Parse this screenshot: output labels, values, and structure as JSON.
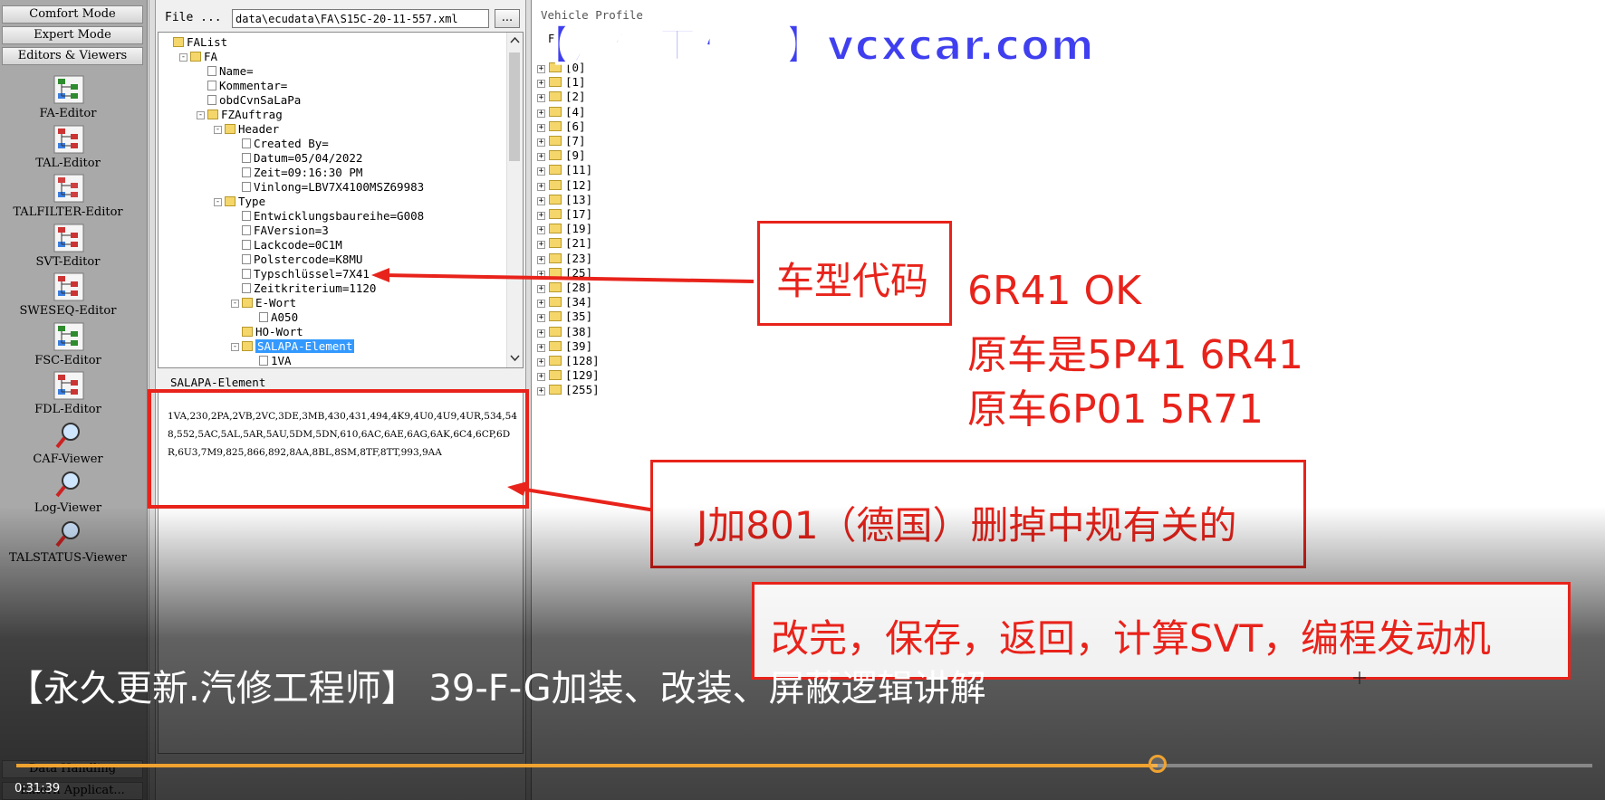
{
  "left_toolbar": {
    "modes": [
      "Comfort Mode",
      "Expert Mode",
      "Editors & Viewers"
    ],
    "tools": [
      {
        "label": "FA-Editor",
        "icon": "fa-editor-icon"
      },
      {
        "label": "TAL-Editor",
        "icon": "tal-editor-icon"
      },
      {
        "label": "TALFILTER-Editor",
        "icon": "talfilter-editor-icon"
      },
      {
        "label": "SVT-Editor",
        "icon": "svt-editor-icon"
      },
      {
        "label": "SWESEQ-Editor",
        "icon": "sweseq-editor-icon"
      },
      {
        "label": "FSC-Editor",
        "icon": "fsc-editor-icon"
      },
      {
        "label": "FDL-Editor",
        "icon": "fdl-editor-icon"
      },
      {
        "label": "CAF-Viewer",
        "icon": "magnifier-icon"
      },
      {
        "label": "Log-Viewer",
        "icon": "magnifier-icon"
      },
      {
        "label": "TALSTATUS-Viewer",
        "icon": "magnifier-icon"
      }
    ],
    "bottom_buttons": [
      "Data Handling",
      "Extern Applicat..."
    ]
  },
  "file": {
    "label": "File ...",
    "path": "data\\ecudata\\FA\\S15C-20-11-557.xml",
    "browse_label": "..."
  },
  "tree": [
    {
      "text": "FAList",
      "icon": "folder",
      "pm": "none"
    },
    {
      "text": "FA",
      "icon": "folder",
      "pm": "-"
    },
    {
      "text": "Name=",
      "icon": "doc",
      "pm": "none"
    },
    {
      "text": "Kommentar=",
      "icon": "doc",
      "pm": "none"
    },
    {
      "text": "obdCvnSaLaPa",
      "icon": "doc",
      "pm": "none"
    },
    {
      "text": "FZAuftrag",
      "icon": "folder",
      "pm": "-"
    },
    {
      "text": "Header",
      "icon": "folder",
      "pm": "-"
    },
    {
      "text": "Created By=",
      "icon": "doc",
      "pm": "none"
    },
    {
      "text": "Datum=05/04/2022",
      "icon": "doc",
      "pm": "none"
    },
    {
      "text": "Zeit=09:16:30 PM",
      "icon": "doc",
      "pm": "none"
    },
    {
      "text": "Vinlong=LBV7X4100MSZ69983",
      "icon": "doc",
      "pm": "none"
    },
    {
      "text": "Type",
      "icon": "folder",
      "pm": "-"
    },
    {
      "text": "Entwicklungsbaureihe=G008",
      "icon": "doc",
      "pm": "none"
    },
    {
      "text": "FAVersion=3",
      "icon": "doc",
      "pm": "none"
    },
    {
      "text": "Lackcode=0C1M",
      "icon": "doc",
      "pm": "none"
    },
    {
      "text": "Polstercode=K8MU",
      "icon": "doc",
      "pm": "none"
    },
    {
      "text": "Typschlüssel=7X41",
      "icon": "doc",
      "pm": "none"
    },
    {
      "text": "Zeitkriterium=1120",
      "icon": "doc",
      "pm": "none"
    },
    {
      "text": "E-Wort",
      "icon": "folder",
      "pm": "-"
    },
    {
      "text": "A050",
      "icon": "doc",
      "pm": "none"
    },
    {
      "text": "HO-Wort",
      "icon": "folder",
      "pm": "none"
    },
    {
      "text": "SALAPA-Element",
      "icon": "folder",
      "pm": "-",
      "selected": true
    },
    {
      "text": "1VA",
      "icon": "doc",
      "pm": "none"
    }
  ],
  "salapa": {
    "header": "SALAPA-Element",
    "text": "1VA,230,2PA,2VB,2VC,3DE,3MB,430,431,494,4K9,4U0,4U9,4UR,534,548,552,5AC,5AL,5AR,5AU,5DM,5DN,610,6AC,6AE,6AG,6AK,6C4,6CP,6DR,6U3,7M9,825,866,892,8AA,8BL,8SM,8TF,8TT,993,9AA"
  },
  "vehicle_profile": {
    "title": "Vehicle Profile",
    "tab": "FP",
    "items": [
      "[0]",
      "[1]",
      "[2]",
      "[4]",
      "[6]",
      "[7]",
      "[9]",
      "[11]",
      "[12]",
      "[13]",
      "[17]",
      "[19]",
      "[21]",
      "[23]",
      "[25]",
      "[28]",
      "[34]",
      "[35]",
      "[38]",
      "[39]",
      "[128]",
      "[129]",
      "[255]"
    ]
  },
  "annotations": {
    "watermark": "【汽修工程师】vcxcar.com",
    "box1_text": "车型代码",
    "note_lines": [
      "6R41    OK",
      "原车是5P41    6R41",
      "原车6P01       5R71"
    ],
    "box2_text": "J加801（德国）删掉中规有关的",
    "box3_text": "改完，保存，返回，计算SVT，编程发动机",
    "accent_color": "#e8231b"
  },
  "video": {
    "title": "【永久更新.汽修工程师】 39-F-G加装、改装、屏蔽逻辑讲解",
    "time": "0:31:39",
    "progress": 0.724,
    "progress_color": "#f0a330"
  }
}
